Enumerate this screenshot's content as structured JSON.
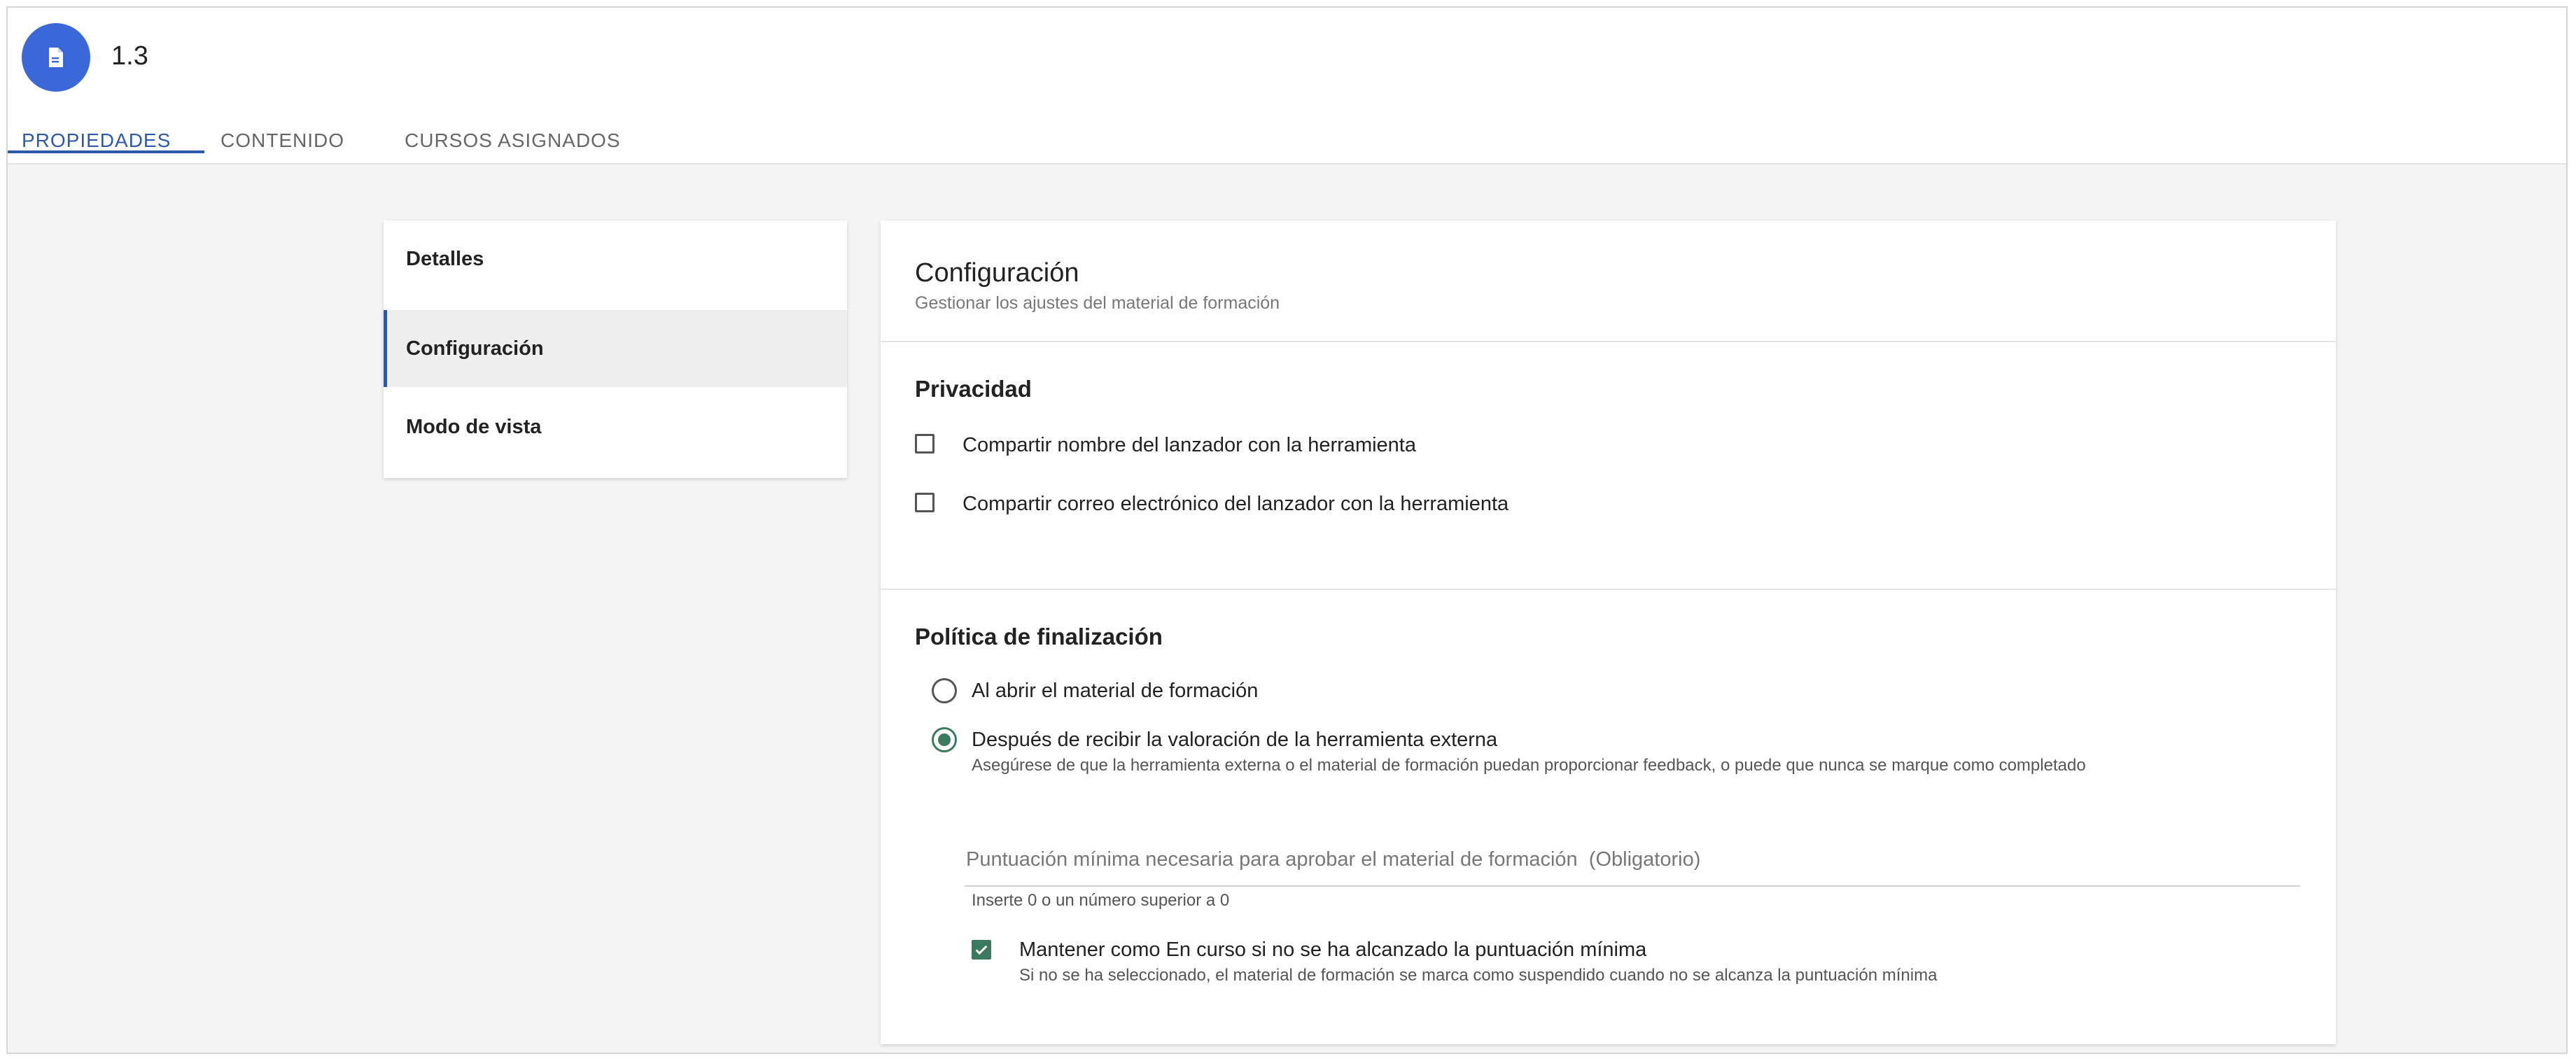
{
  "header": {
    "title": "1.3",
    "icon": "document-icon",
    "accent_color": "#3b68d9"
  },
  "tabs": [
    {
      "label": "PROPIEDADES",
      "active": true
    },
    {
      "label": "CONTENIDO",
      "active": false
    },
    {
      "label": "CURSOS ASIGNADOS",
      "active": false
    }
  ],
  "sidenav": {
    "items": [
      {
        "label": "Detalles",
        "selected": false
      },
      {
        "label": "Configuración",
        "selected": true
      },
      {
        "label": "Modo de vista",
        "selected": false
      }
    ]
  },
  "panel": {
    "title": "Configuración",
    "subtitle": "Gestionar los ajustes del material de formación",
    "privacy": {
      "title": "Privacidad",
      "options": [
        {
          "label": "Compartir nombre del lanzador con la herramienta",
          "checked": false
        },
        {
          "label": "Compartir correo electrónico del lanzador con la herramienta",
          "checked": false
        }
      ]
    },
    "completion": {
      "title": "Política de finalización",
      "radio_open": {
        "label": "Al abrir el material de formación",
        "selected": false
      },
      "radio_score": {
        "label": "Después de recibir la valoración de la herramienta externa",
        "help": "Asegúrese de que la herramienta externa o el material de formación puedan proporcionar feedback, o puede que nunca se marque como completado",
        "selected": true
      },
      "score_field": {
        "placeholder": "Puntuación mínima necesaria para aprobar el material de formación  (Obligatorio)",
        "value": "",
        "hint": "Inserte 0 o un número superior a 0"
      },
      "keep_in_progress": {
        "label": "Mantener como En curso si no se ha alcanzado la puntuación mínima",
        "help": "Si no se ha seleccionado, el material de formación se marca como suspendido cuando no se alcanza la puntuación mínima",
        "checked": true
      }
    }
  },
  "colors": {
    "tab_active": "#2c5aa8",
    "check_green": "#3b7a5e"
  }
}
